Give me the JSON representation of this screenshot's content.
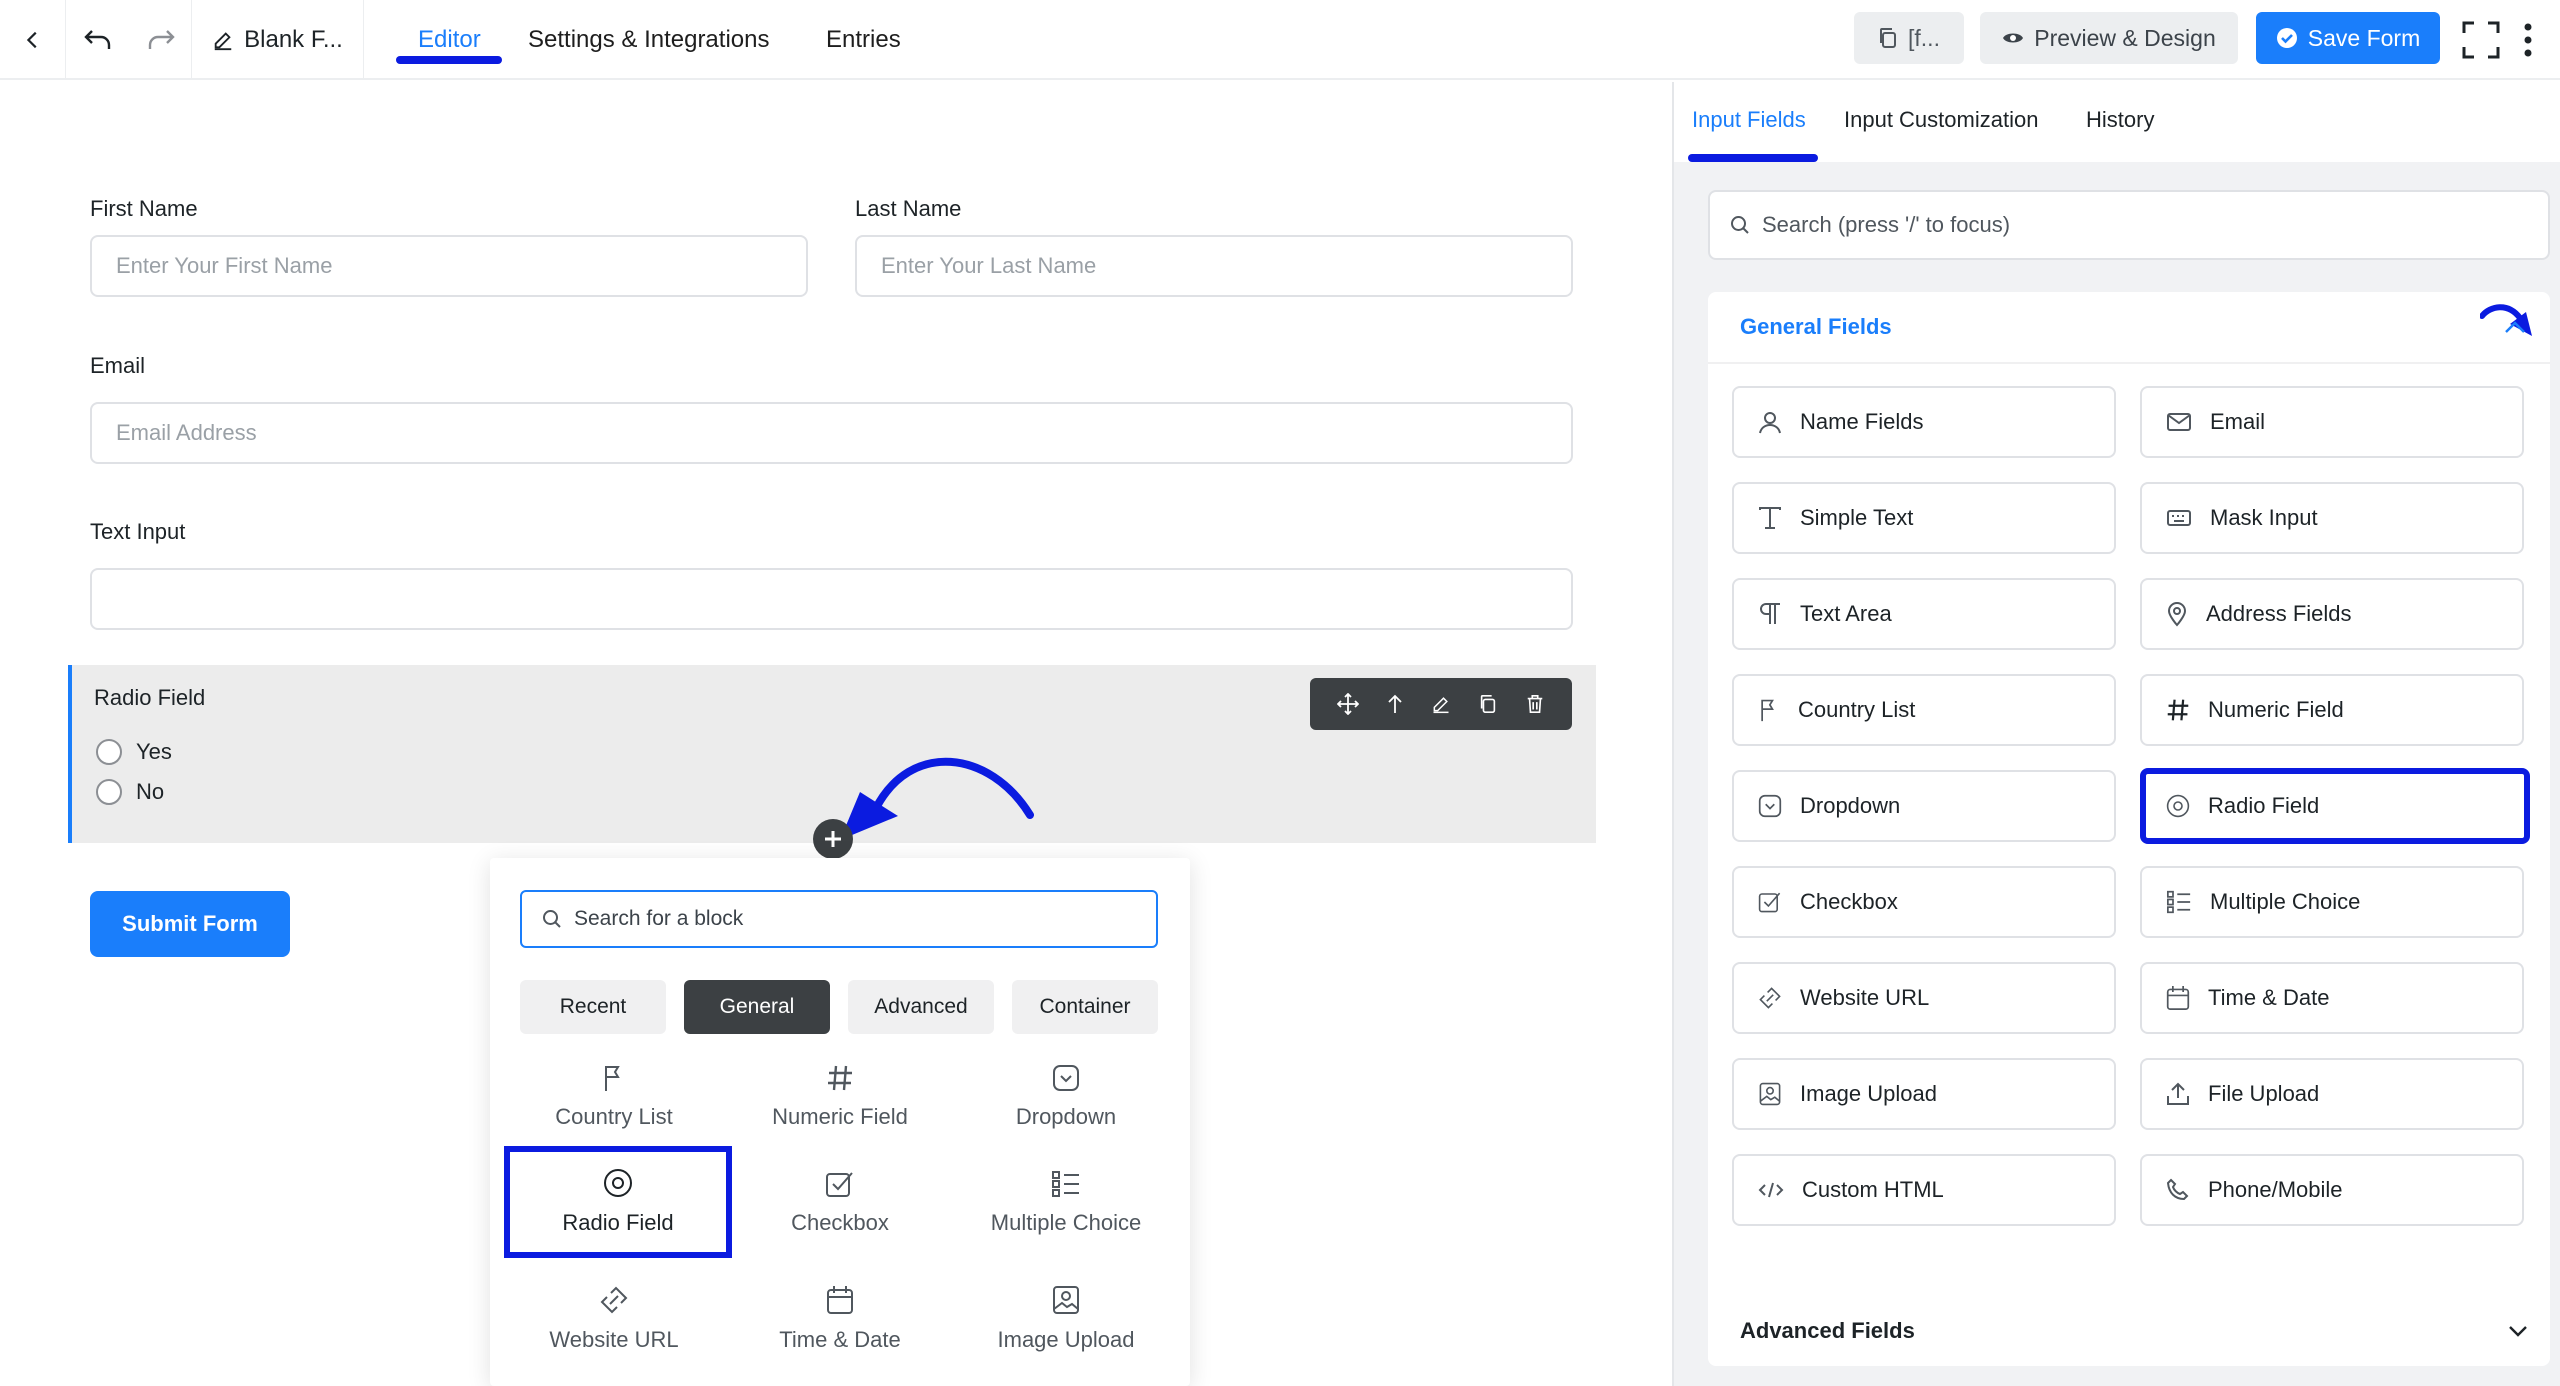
{
  "topbar": {
    "form_title": "Blank F...",
    "tabs": [
      "Editor",
      "Settings & Integrations",
      "Entries"
    ],
    "shortcode_label": "[f...",
    "preview_label": "Preview & Design",
    "save_label": "Save Form"
  },
  "form": {
    "first_name_label": "First Name",
    "first_name_placeholder": "Enter Your First Name",
    "last_name_label": "Last Name",
    "last_name_placeholder": "Enter Your Last Name",
    "email_label": "Email",
    "email_placeholder": "Email Address",
    "text_input_label": "Text Input",
    "radio_label": "Radio Field",
    "radio_options": [
      "Yes",
      "No"
    ],
    "submit_label": "Submit Form"
  },
  "inserter": {
    "search_placeholder": "Search for a block",
    "tabs": [
      "Recent",
      "General",
      "Advanced",
      "Container"
    ],
    "active_tab": "General",
    "items": [
      "Country List",
      "Numeric Field",
      "Dropdown",
      "Radio Field",
      "Checkbox",
      "Multiple Choice",
      "Website URL",
      "Time & Date",
      "Image Upload"
    ]
  },
  "sidebar": {
    "tabs": [
      "Input Fields",
      "Input Customization",
      "History"
    ],
    "active_tab": "Input Fields",
    "search_placeholder": "Search (press '/' to focus)",
    "general_title": "General Fields",
    "fields": [
      "Name Fields",
      "Email",
      "Simple Text",
      "Mask Input",
      "Text Area",
      "Address Fields",
      "Country List",
      "Numeric Field",
      "Dropdown",
      "Radio Field",
      "Checkbox",
      "Multiple Choice",
      "Website URL",
      "Time & Date",
      "Image Upload",
      "File Upload",
      "Custom HTML",
      "Phone/Mobile"
    ],
    "advanced_title": "Advanced Fields"
  },
  "colors": {
    "accent": "#1a7efb",
    "highlight": "#0b1be0",
    "toolbar": "#3c4043"
  }
}
